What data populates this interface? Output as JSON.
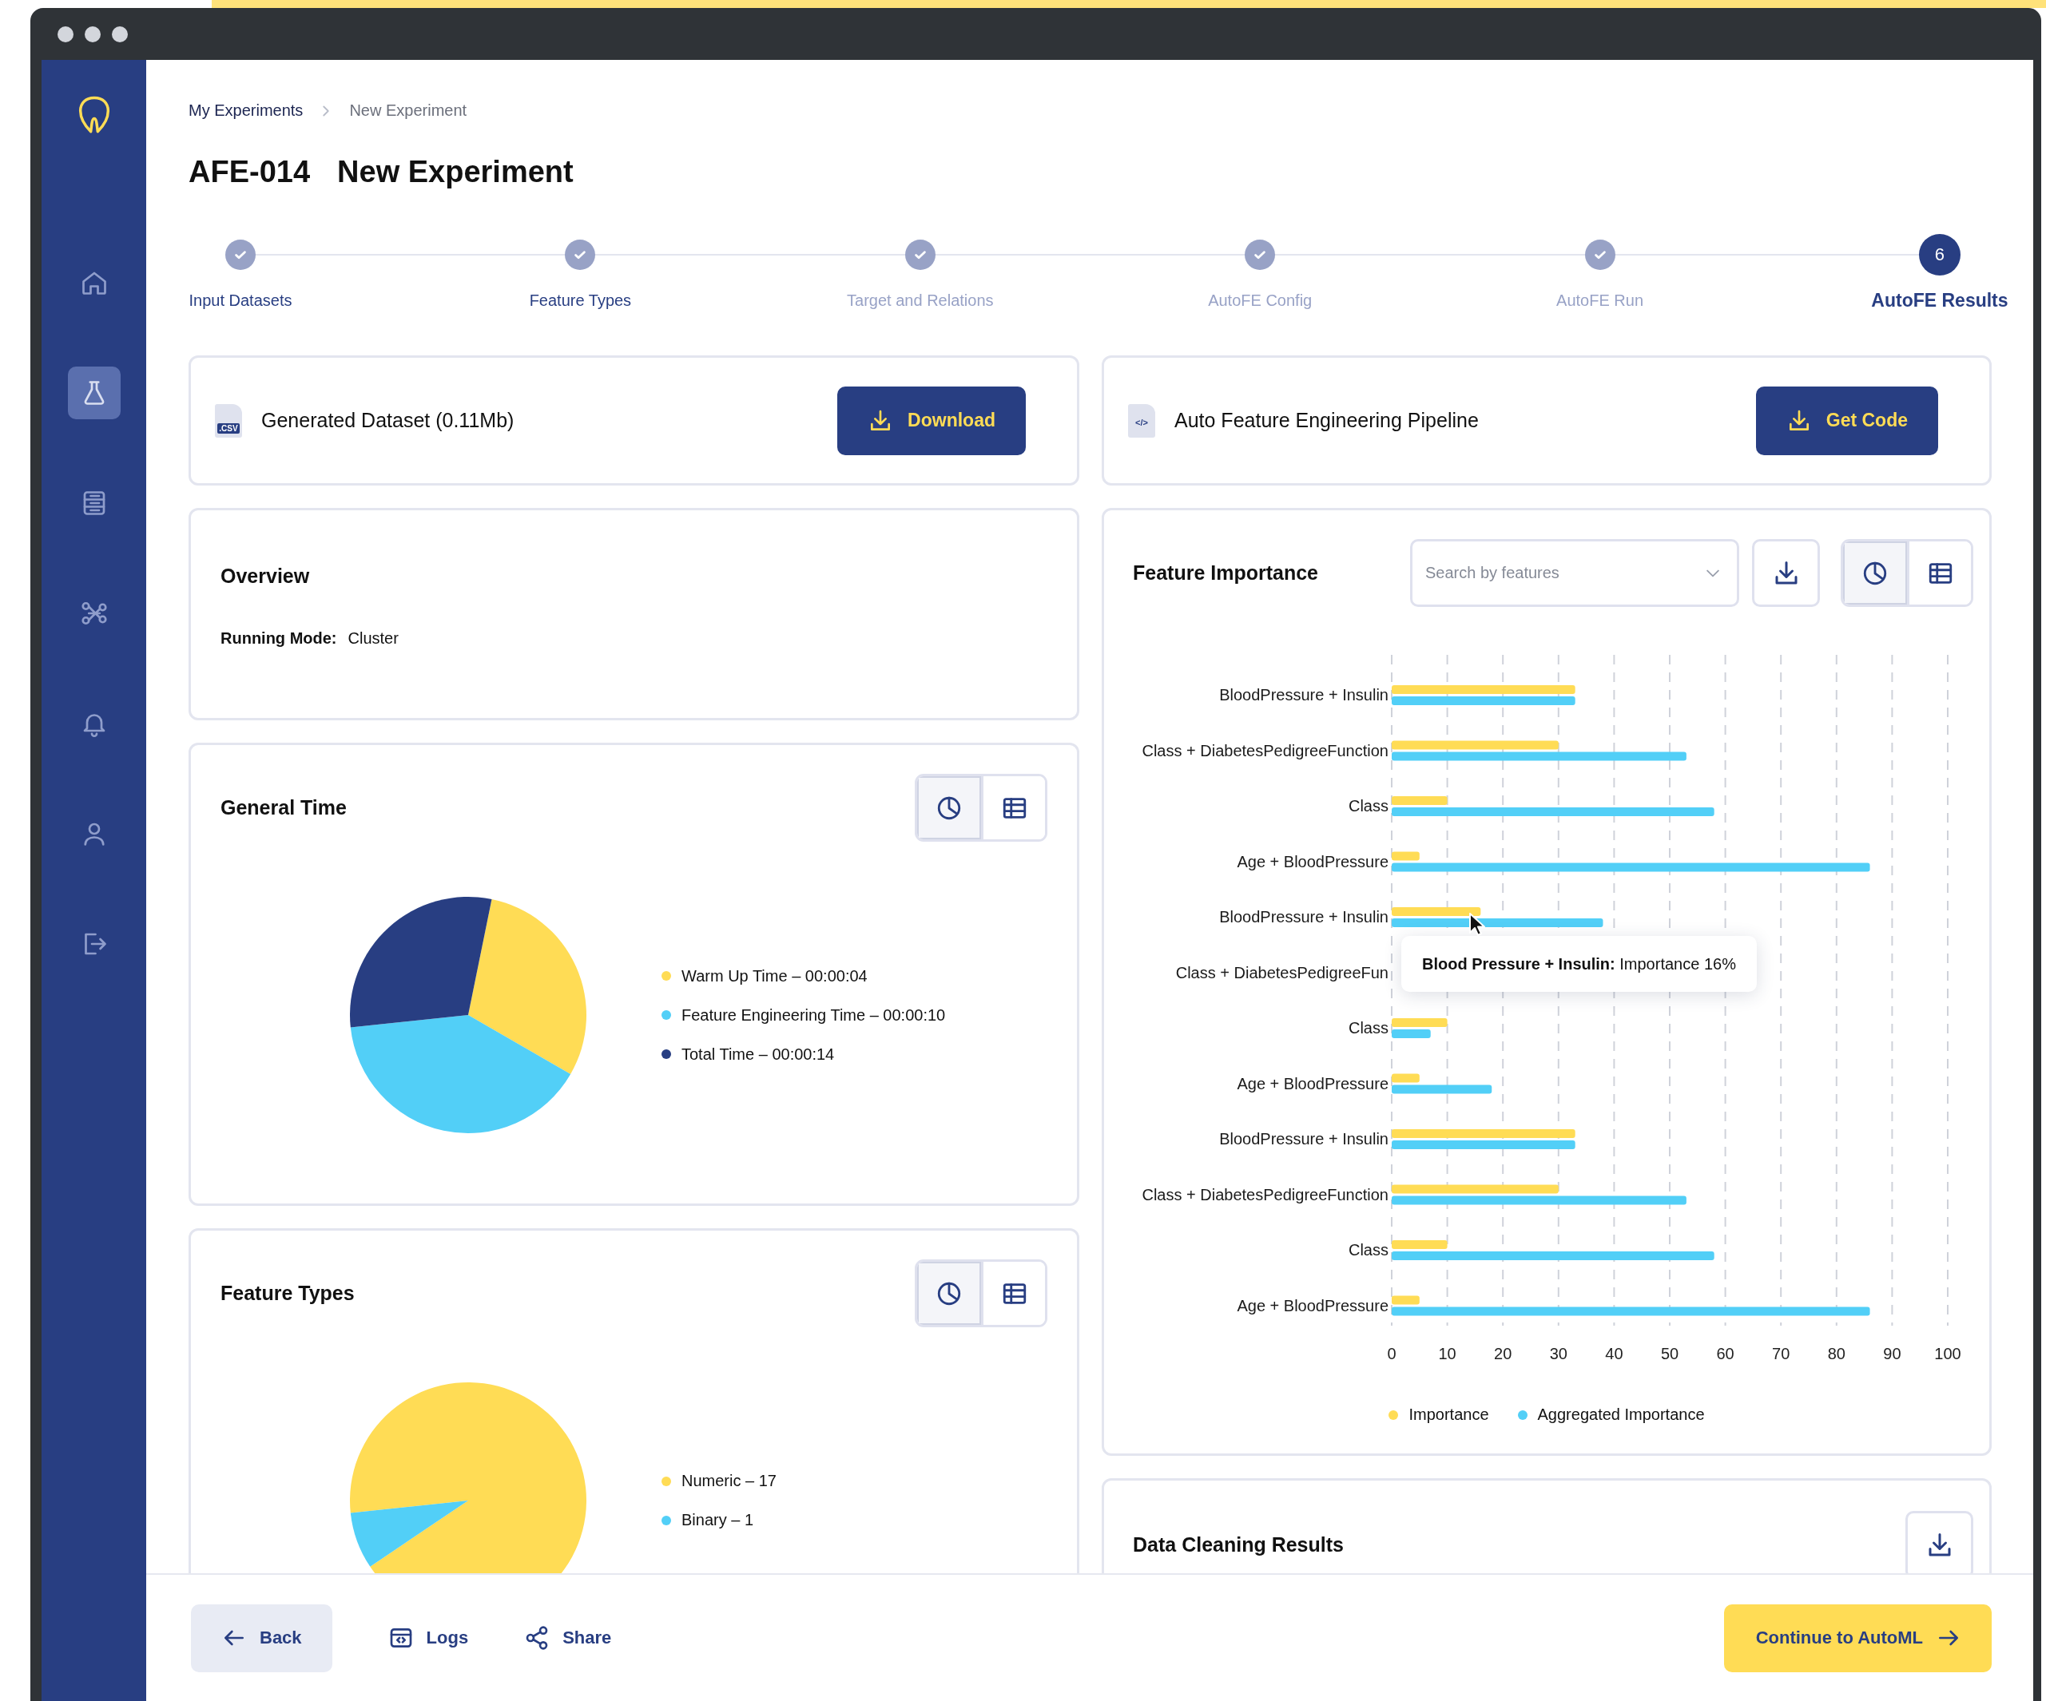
{
  "sidebar": {
    "items": [
      {
        "selected": false
      },
      {
        "selected": true
      },
      {
        "selected": false
      },
      {
        "selected": false
      },
      {
        "selected": false
      },
      {
        "selected": false
      },
      {
        "selected": false
      }
    ]
  },
  "breadcrumb": [
    {
      "label": "My Experiments",
      "current": false
    },
    {
      "label": "New Experiment",
      "current": true
    }
  ],
  "title": {
    "id": "AFE-014",
    "name": "New Experiment"
  },
  "steps": [
    {
      "label": "Input Datasets",
      "completed": true,
      "disabled": false,
      "selected": false
    },
    {
      "label": "Feature Types",
      "completed": true,
      "disabled": false,
      "selected": false
    },
    {
      "label": "Target and Relations",
      "completed": true,
      "disabled": true,
      "selected": false
    },
    {
      "label": "AutoFE Config",
      "completed": true,
      "disabled": true,
      "selected": false
    },
    {
      "label": "AutoFE Run",
      "completed": true,
      "disabled": true,
      "selected": false
    },
    {
      "label": "AutoFE Results",
      "number": "6",
      "completed": false,
      "disabled": false,
      "selected": true
    }
  ],
  "files": [
    {
      "icon_text": ".CSV",
      "title": "Generated Dataset (0.11Mb)",
      "button": "Download"
    },
    {
      "icon_text": "</>",
      "title": "Auto Feature Engineering Pipeline",
      "button": "Get Code"
    }
  ],
  "overview": {
    "title": "Overview",
    "fields": [
      {
        "label": "Running Mode:",
        "value": "Cluster"
      }
    ]
  },
  "general_time": {
    "title": "General Time",
    "view_toggle": [
      {
        "selected": true
      },
      {
        "selected": false
      }
    ],
    "legend": [
      {
        "label": "Warm Up Time – 00:00:04",
        "color": "#ffdc55"
      },
      {
        "label": "Feature Engineering Time – 00:00:10",
        "color": "#52cff7"
      },
      {
        "label": "Total Time – 00:00:14",
        "color": "#283e82"
      }
    ]
  },
  "feature_types": {
    "title": "Feature Types",
    "view_toggle": [
      {
        "selected": true
      },
      {
        "selected": false
      }
    ],
    "legend": [
      {
        "label": "Numeric – 17",
        "color": "#ffdc55"
      },
      {
        "label": "Binary – 1",
        "color": "#52cff7"
      }
    ]
  },
  "feature_importance": {
    "title": "Feature Importance",
    "search": {
      "placeholder": "Search by features"
    },
    "view_toggle": [
      {
        "selected": true
      },
      {
        "selected": false
      }
    ],
    "chart_data": {
      "type": "bar",
      "orientation": "horizontal",
      "categories": [
        "BloodPressure + Insulin",
        "Class + DiabetesPedigreeFunction",
        "Class",
        "Age + BloodPressure",
        "BloodPressure + Insulin",
        "Class + DiabetesPedigreeFun",
        "Class",
        "Age + BloodPressure",
        "BloodPressure + Insulin",
        "Class + DiabetesPedigreeFunction",
        "Class",
        "Age + BloodPressure"
      ],
      "series": [
        {
          "name": "Importance",
          "color": "#ffdc55",
          "values": [
            33,
            30,
            10,
            5,
            16,
            null,
            10,
            5,
            33,
            30,
            10,
            5
          ]
        },
        {
          "name": "Aggregated Importance",
          "color": "#52cff7",
          "values": [
            33,
            53,
            58,
            86,
            38,
            null,
            7,
            18,
            33,
            53,
            58,
            86
          ]
        }
      ],
      "grid": true,
      "xlim": [
        0,
        100
      ],
      "xticks": [
        0,
        10,
        20,
        30,
        40,
        50,
        60,
        70,
        80,
        90,
        100
      ]
    },
    "tooltip": "**Blood Pressure + Insulin:** Importance 16%"
  },
  "data_cleaning": {
    "title": "Data Cleaning Results"
  },
  "footer": {
    "buttons": [
      {
        "kind": "back",
        "label": "Back"
      },
      {
        "kind": "logs",
        "label": "Logs"
      },
      {
        "kind": "share",
        "label": "Share"
      },
      {
        "kind": "continue",
        "label": "Continue to AutoML"
      }
    ]
  }
}
